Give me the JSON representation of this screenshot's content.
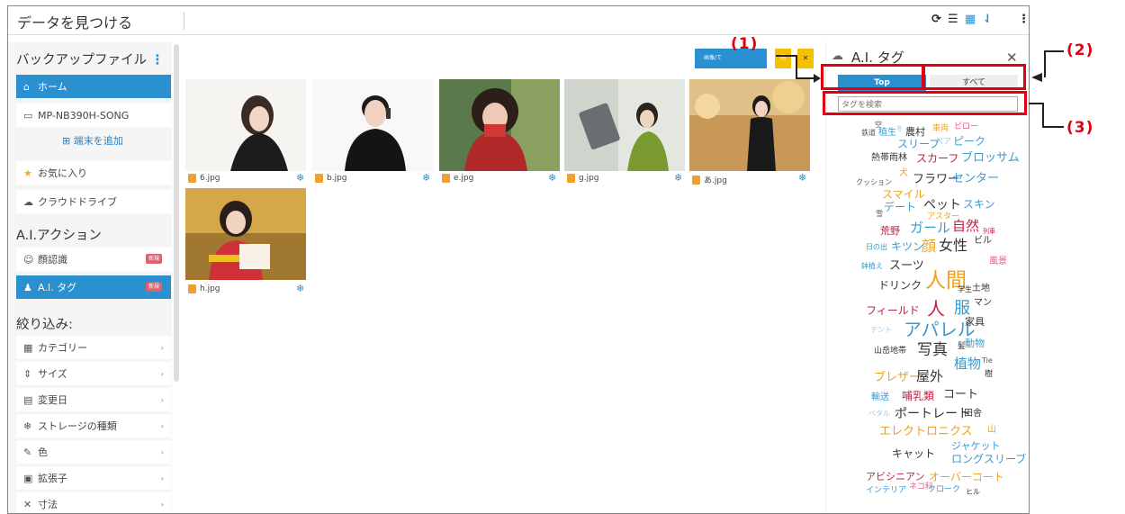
{
  "app": {
    "title": "データを見つける"
  },
  "toolbar": {
    "icons": [
      "refresh-icon",
      "list-view-icon",
      "grid-view-icon",
      "sort-icon",
      "more-icon"
    ]
  },
  "sidebar": {
    "backup_header": "バックアップファイル",
    "items": [
      {
        "label": "ホーム",
        "icon": "home-icon"
      },
      {
        "label": "MP-NB390H-SONG",
        "icon": "laptop-icon"
      }
    ],
    "add_device": "端末を追加",
    "favorites": "お気に入り",
    "cloud": "クラウドドライブ",
    "ai_header": "A.I.アクション",
    "ai_items": [
      {
        "label": "顔認識",
        "badge": "新規"
      },
      {
        "label": "A.I. タグ",
        "badge": "新規"
      }
    ],
    "filter_header": "絞り込み:",
    "filters": [
      "カテゴリー",
      "サイズ",
      "変更日",
      "ストレージの種類",
      "色",
      "拡張子",
      "寸法"
    ]
  },
  "main": {
    "action_button": "画像/て",
    "action_small": "閉",
    "files": [
      "6.jpg",
      "b.jpg",
      "e.jpg",
      "g.jpg",
      "あ.jpg",
      "h.jpg"
    ]
  },
  "tag_panel": {
    "title": "A.I. タグ",
    "tabs": [
      "Top",
      "すべて"
    ],
    "search_placeholder": "タグを検索",
    "tags": [
      "空",
      "鉄道",
      "植生",
      "冬",
      "農村",
      "車両",
      "ピロー",
      "スリープ",
      "ペア",
      "ピーク",
      "熱帯雨林",
      "スカーフ",
      "ブロッサム",
      "犬",
      "クッション",
      "フラワー",
      "センター",
      "スマイル",
      "雪",
      "デート",
      "ペット",
      "スキン",
      "アスター",
      "荒野",
      "ガール",
      "自然",
      "列車",
      "日の出",
      "キツン",
      "顔",
      "女性",
      "ビル",
      "鉢植え",
      "スーツ",
      "風景",
      "ドリンク",
      "人間",
      "学生",
      "土地",
      "フィールド",
      "人",
      "服",
      "マン",
      "テント",
      "アパレル",
      "家具",
      "山岳地帯",
      "写真",
      "髪",
      "動物",
      "植物",
      "Tie",
      "ブレザー",
      "屋外",
      "樹",
      "輸送",
      "哺乳類",
      "コート",
      "ペタル",
      "ポートレート",
      "田舎",
      "エレクトロニクス",
      "山",
      "ジャケット",
      "キャット",
      "ロングスリーブ",
      "アビシニアン",
      "オーバーコート",
      "インテリア",
      "ネコ科",
      "クローク",
      "ヒル"
    ]
  },
  "annotations": {
    "c1": "(1)",
    "c2": "(2)",
    "c3": "(3)"
  },
  "colors": {
    "accent": "#2a90d0",
    "callout": "#e00010",
    "badge": "#e06070"
  }
}
